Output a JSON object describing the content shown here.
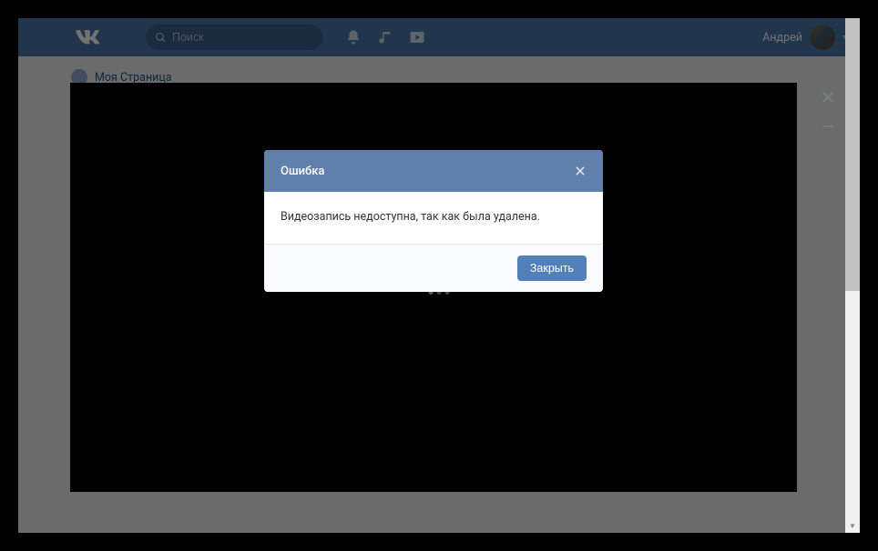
{
  "topbar": {
    "search_placeholder": "Поиск",
    "username": "Андрей"
  },
  "sidebar": {
    "items": [
      {
        "label": "Моя Страница"
      }
    ]
  },
  "modal": {
    "title": "Ошибка",
    "message": "Видеозапись недоступна, так как была удалена.",
    "close_button": "Закрыть"
  }
}
